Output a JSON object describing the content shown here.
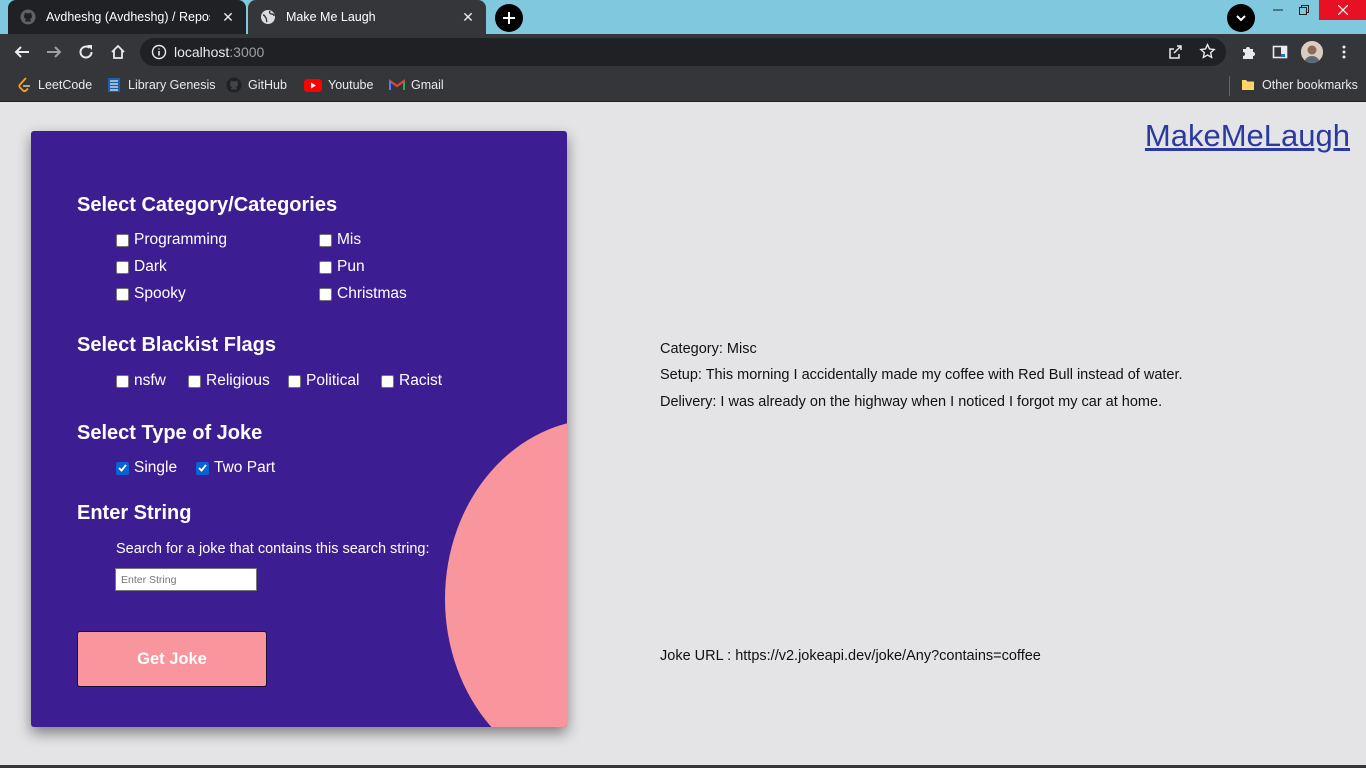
{
  "browser": {
    "tabs": [
      {
        "title": "Avdheshg (Avdheshg) / Repositor"
      },
      {
        "title": "Make Me Laugh"
      }
    ],
    "url_host": "localhost",
    "url_port": ":3000",
    "bookmarks": [
      {
        "label": "LeetCode",
        "icon": "leetcode-icon"
      },
      {
        "label": "Library Genesis",
        "icon": "library-icon"
      },
      {
        "label": "GitHub",
        "icon": "github-icon"
      },
      {
        "label": "Youtube",
        "icon": "youtube-icon"
      },
      {
        "label": "Gmail",
        "icon": "gmail-icon"
      }
    ],
    "other_bookmarks": "Other bookmarks"
  },
  "form": {
    "category_heading": "Select Category/Categories",
    "categories": [
      {
        "label": "Programming",
        "checked": false
      },
      {
        "label": "Mis",
        "checked": false
      },
      {
        "label": "Dark",
        "checked": false
      },
      {
        "label": "Pun",
        "checked": false
      },
      {
        "label": "Spooky",
        "checked": false
      },
      {
        "label": "Christmas",
        "checked": false
      }
    ],
    "blacklist_heading": "Select Blackist Flags",
    "flags": [
      {
        "label": "nsfw",
        "checked": false
      },
      {
        "label": "Religious",
        "checked": false
      },
      {
        "label": "Political",
        "checked": false
      },
      {
        "label": "Racist",
        "checked": false
      }
    ],
    "type_heading": "Select Type of Joke",
    "types": [
      {
        "label": "Single",
        "checked": true
      },
      {
        "label": "Two Part",
        "checked": true
      }
    ],
    "string_heading": "Enter String",
    "string_hint": "Search for a joke that contains this search string:",
    "string_placeholder": "Enter String",
    "button_label": "Get Joke"
  },
  "brand": "MakeMeLaugh",
  "joke": {
    "category": "Category: Misc",
    "setup": "Setup: This morning I accidentally made my coffee with Red Bull instead of water.",
    "delivery": "Delivery: I was already on the highway when I noticed I forgot my car at home.",
    "url": "Joke URL : https://v2.jokeapi.dev/joke/Any?contains=coffee"
  },
  "colors": {
    "card": "#3d1e92",
    "accent": "#f8959d",
    "page_bg": "#e4e4e7",
    "link": "#2a3aa0"
  }
}
